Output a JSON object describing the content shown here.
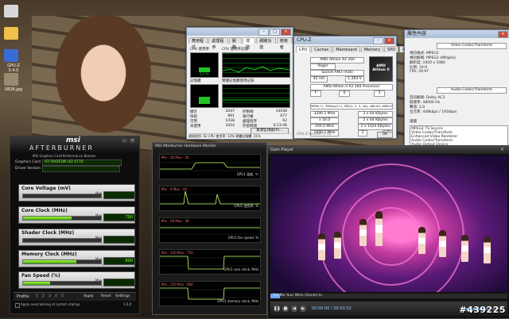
{
  "desktop": {
    "icons": [
      {
        "label": "",
        "color": "#d8d8d8"
      },
      {
        "label": "",
        "color": "#f0c04a"
      },
      {
        "label": "GPU-Z 0.4.0",
        "color": "#3a6cd6"
      },
      {
        "label": "0826.jpg",
        "color": "#9a8a70"
      }
    ]
  },
  "task_manager": {
    "tabs": [
      "應用程式",
      "處理程序",
      "服務",
      "效能",
      "網路功能",
      "使用者"
    ],
    "active_tab_index": 3,
    "cpu_usage_label": "CPU 使用率",
    "cpu_history_label": "CPU 使用率記錄",
    "mem_label": "記憶體",
    "mem_history_label": "實體記憶體使用記錄",
    "cpu_value": "13 %",
    "stats_left": [
      [
        "總計",
        "2047"
      ],
      [
        "快取",
        "891"
      ],
      [
        "可用",
        "1438"
      ],
      [
        "未使用",
        "1024"
      ]
    ],
    "stats_right": [
      [
        "控制碼",
        "14036"
      ],
      [
        "執行緒",
        "677"
      ],
      [
        "處理程序",
        "62"
      ],
      [
        "存留時間",
        "0:13:46"
      ]
    ],
    "resource_monitor_button": "資源監視器(R)...",
    "status": "處理程序: 62   CPU 使用率: 13%   實體記憶體: 31%"
  },
  "cpuz": {
    "title": "CPU-Z",
    "tabs": [
      "CPU",
      "Caches",
      "Mainboard",
      "Memory",
      "SPD",
      "About"
    ],
    "name": "AMD Athlon X4 260",
    "codename": "Regor",
    "package": "Socket AM3 (938)",
    "technology": "45 nm",
    "voltage": "1.264 V",
    "spec": "AMD Athlon II X2 260 Processor",
    "family": "F",
    "model": "6",
    "stepping": "3",
    "instructions": "MMX(+), 3DNow!(+), SSE(1, 2, 3, 4A), x86-64, AMD-V",
    "core_speed": "3200.1 MHz",
    "multiplier": "x 16.0",
    "bus_speed": "200.0 MHz",
    "ht_link": "2000.1 MHz",
    "l1d": "2 x 64 KBytes",
    "l1i": "2 x 64 KBytes",
    "l2": "2 x 1024 KBytes",
    "cores": "2",
    "threads": "2",
    "version": "CPU-Z  Version 1.55",
    "logo_text": "AMD Athlon II",
    "ok_button": "OK"
  },
  "props": {
    "title": "屬性內容",
    "section1": "Video Codec/Transform",
    "video_info": [
      [
        "視訊格式:",
        "MPEG2"
      ],
      [
        "視訊解碼:",
        "MPEG2 (MP@HL)"
      ],
      [
        "解析度:",
        "1920 x 1080"
      ],
      [
        "比例:",
        "16:9"
      ],
      [
        "FPS:",
        "29.97"
      ]
    ],
    "section2": "Audio Codec/Transform",
    "audio_info": [
      [
        "音訊解碼:",
        "Dolby AC3"
      ],
      [
        "取樣率:",
        "48000 Hz"
      ],
      [
        "聲道:",
        "2.0"
      ],
      [
        "位元率:",
        "448kbps / 192kbps"
      ]
    ],
    "filters_title": "濾鏡",
    "filters": [
      "MPEG2 TS Source",
      "Video Codec/Transform",
      "Enhanced Video Renderer",
      "Audio Codec/Transform",
      "Audio Output Device",
      "DirectSound Audio Renderer"
    ]
  },
  "afterburner": {
    "brand": "msi",
    "name": "AFTERBURNER",
    "subtitle": "MSI Graphics Card Performance Booster",
    "graphics_card_label": "Graphics Card",
    "graphics_card_value": "ATI RADEON HD 4770",
    "driver_label": "Driver Version",
    "sliders": [
      {
        "label": "Core Voltage (mV)",
        "value": "",
        "fraction": 0.0
      },
      {
        "label": "Core Clock (MHz)",
        "value": "700",
        "fraction": 0.62
      },
      {
        "label": "Shader Clock (MHz)",
        "value": "",
        "fraction": 0.0
      },
      {
        "label": "Memory Clock (MHz)",
        "value": "800",
        "fraction": 0.68
      },
      {
        "label": "Fan Speed (%)",
        "value": "",
        "fraction": 0.35
      }
    ],
    "max_label": "Max",
    "profile_label": "Profile",
    "profile_slots": [
      "1",
      "2",
      "3",
      "4",
      "5"
    ],
    "buttons": [
      "Apply",
      "Reset",
      "Settings"
    ],
    "startup_text": "Apply overclocking at system startup",
    "version": "1.6.0"
  },
  "hwmon": {
    "title": "MSI Afterburner Hardware Monitor",
    "graphs": [
      {
        "name": "GPU1 溫度, ℃",
        "min": "Min : 40",
        "max": "Max : 50"
      },
      {
        "name": "GPU1 使用率, %",
        "min": "Min : 0",
        "max": "Max : 44"
      },
      {
        "name": "GPU1 fan speed, %",
        "min": "Min : 28",
        "max": "Max : 28"
      },
      {
        "name": "GPU1 core clock, MHz",
        "min": "Min : 240",
        "max": "Max : 750"
      },
      {
        "name": "GPU1 memory clock, MHz",
        "min": "Min : 250",
        "max": "Max : 800"
      }
    ]
  },
  "player": {
    "title": "Gom Player",
    "file": "Tell Me Your Wish (Genie).ts",
    "time": "00:00:00 / 00:03:52",
    "progress": 0.04
  },
  "watermark": "#439225"
}
